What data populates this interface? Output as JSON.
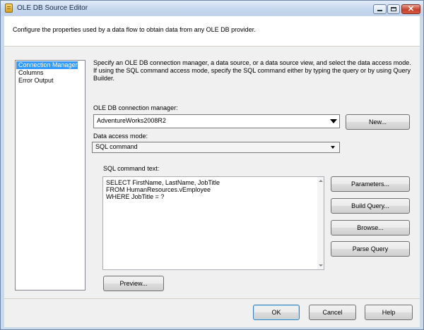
{
  "window": {
    "title": "OLE DB Source Editor"
  },
  "header": {
    "text": "Configure the properties used by a data flow to obtain data from any OLE DB provider."
  },
  "nav": {
    "items": [
      {
        "label": "Connection Manager",
        "selected": true
      },
      {
        "label": "Columns",
        "selected": false
      },
      {
        "label": "Error Output",
        "selected": false
      }
    ]
  },
  "main": {
    "description": "Specify an OLE DB connection manager, a data source, or a data source view, and select the data access mode. If using the SQL command access mode, specify the SQL command either by typing the query or by using Query Builder.",
    "connection_label": "OLE DB connection manager:",
    "connection_value": "AdventureWorks2008R2",
    "new_button": "New...",
    "access_mode_label": "Data access mode:",
    "access_mode_value": "SQL command",
    "sql_label": "SQL command text:",
    "sql_lines": [
      "SELECT FirstName, LastName, JobTitle",
      "FROM HumanResources.vEmployee",
      "WHERE JobTitle = ?"
    ],
    "parameters_button": "Parameters...",
    "build_query_button": "Build Query...",
    "browse_button": "Browse...",
    "parse_query_button": "Parse Query",
    "preview_button": "Preview..."
  },
  "footer": {
    "ok_button": "OK",
    "cancel_button": "Cancel",
    "help_button": "Help"
  },
  "icons": {
    "app": "ssis-source-icon",
    "minimize": "minimize-icon",
    "maximize": "maximize-icon",
    "close": "close-icon"
  }
}
